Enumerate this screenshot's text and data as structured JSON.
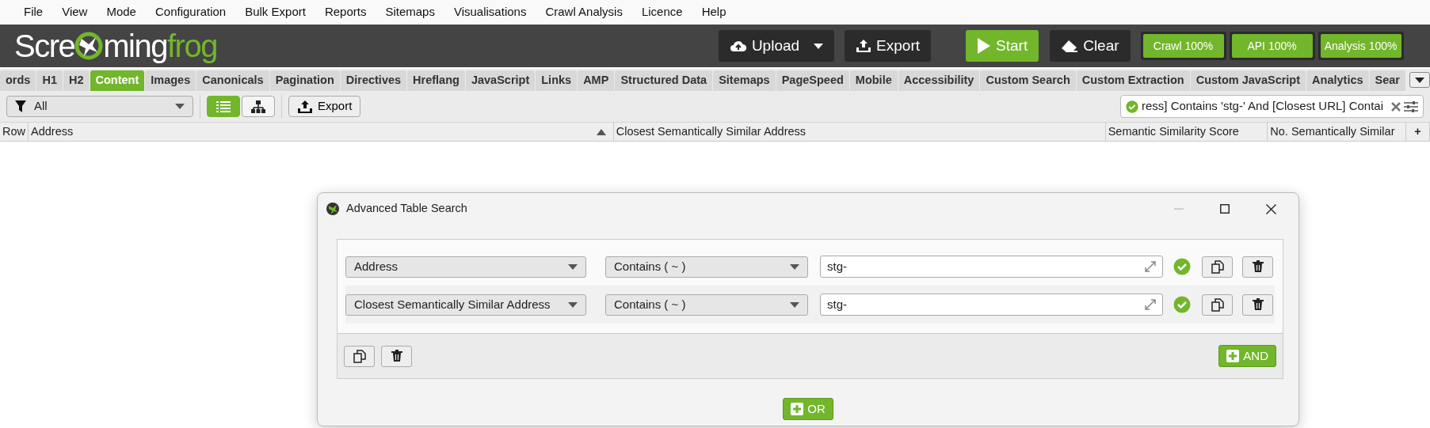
{
  "menu": [
    "File",
    "View",
    "Mode",
    "Configuration",
    "Bulk Export",
    "Reports",
    "Sitemaps",
    "Visualisations",
    "Crawl Analysis",
    "Licence",
    "Help"
  ],
  "logo": {
    "before": "Scre",
    "middle": "ming",
    "accent": "frog"
  },
  "header_buttons": [
    {
      "label": "Upload",
      "kind": "upload"
    },
    {
      "label": "Export",
      "kind": "export"
    },
    {
      "label": "Start",
      "kind": "start"
    },
    {
      "label": "Clear",
      "kind": "clear"
    }
  ],
  "progress": [
    {
      "label": "Crawl 100%",
      "level": 1
    },
    {
      "label": "API 100%",
      "level": 1
    },
    {
      "label": "Analysis 100%",
      "level": 1
    }
  ],
  "tabs": [
    {
      "label": "ords",
      "selected": false
    },
    {
      "label": "H1",
      "selected": false
    },
    {
      "label": "H2",
      "selected": false
    },
    {
      "label": "Content",
      "selected": true
    },
    {
      "label": "Images",
      "selected": false
    },
    {
      "label": "Canonicals",
      "selected": false
    },
    {
      "label": "Pagination",
      "selected": false
    },
    {
      "label": "Directives",
      "selected": false
    },
    {
      "label": "Hreflang",
      "selected": false
    },
    {
      "label": "JavaScript",
      "selected": false
    },
    {
      "label": "Links",
      "selected": false
    },
    {
      "label": "AMP",
      "selected": false
    },
    {
      "label": "Structured Data",
      "selected": false
    },
    {
      "label": "Sitemaps",
      "selected": false
    },
    {
      "label": "PageSpeed",
      "selected": false
    },
    {
      "label": "Mobile",
      "selected": false
    },
    {
      "label": "Accessibility",
      "selected": false
    },
    {
      "label": "Custom Search",
      "selected": false
    },
    {
      "label": "Custom Extraction",
      "selected": false
    },
    {
      "label": "Custom JavaScript",
      "selected": false
    },
    {
      "label": "Analytics",
      "selected": false
    },
    {
      "label": "Sear",
      "selected": false
    }
  ],
  "toolbar": {
    "filter": "All",
    "views": [
      {
        "kind": "list",
        "selected": true
      },
      {
        "kind": "tree",
        "selected": false
      }
    ],
    "export": "Export",
    "search": {
      "value": "ress] Contains 'stg-' And [Closest URL] Contai",
      "valid": true
    }
  },
  "table": {
    "columns": [
      {
        "label": "Row",
        "sorted": false
      },
      {
        "label": "Address",
        "sorted": true
      },
      {
        "label": "Closest Semantically Similar Address",
        "sorted": false
      },
      {
        "label": "Semantic Similarity Score",
        "sorted": false
      },
      {
        "label": "No. Semantically Similar",
        "sorted": false
      }
    ],
    "add_column": "+"
  },
  "dialog": {
    "title": "Advanced Table Search",
    "rules": [
      {
        "field": "Address",
        "operator": "Contains ( ~ )",
        "value": "stg-",
        "valid": true
      },
      {
        "field": "Closest Semantically Similar Address",
        "operator": "Contains ( ~ )",
        "value": "stg-",
        "valid": true
      }
    ],
    "and_button": "AND",
    "or_button": "OR"
  }
}
